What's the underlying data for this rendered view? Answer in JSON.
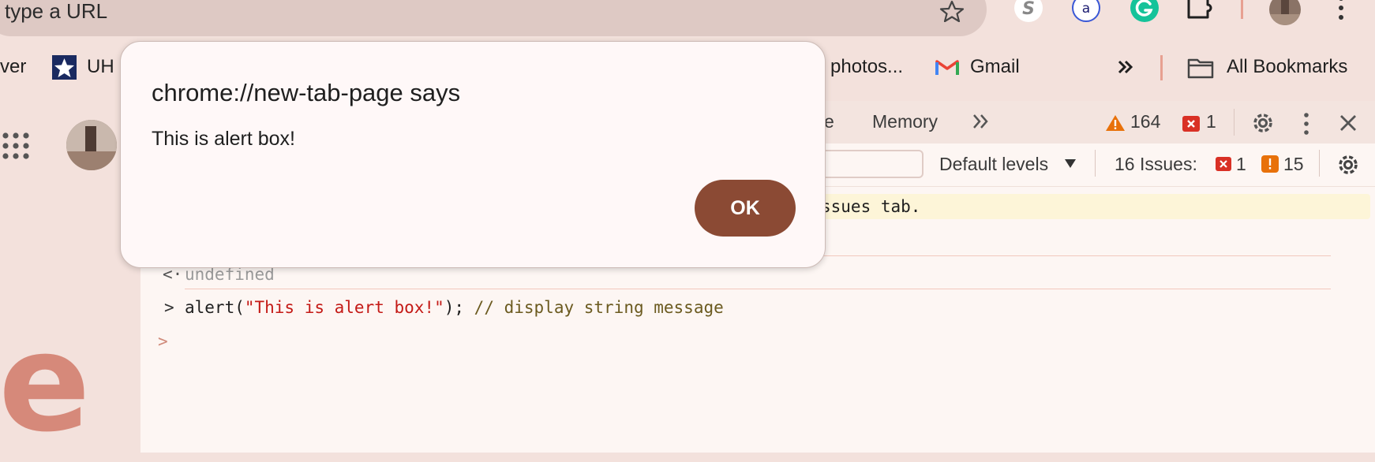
{
  "omnibox": {
    "placeholder_text": "type a URL"
  },
  "bookmarks": {
    "left_partial": "ver",
    "uh": "UH",
    "photos": "photos...",
    "gmail": "Gmail",
    "all_bookmarks": "All Bookmarks"
  },
  "devtools": {
    "tabs": {
      "partial": "e",
      "memory": "Memory"
    },
    "counts": {
      "warnings": "164",
      "errors": "1"
    },
    "filter": {
      "levels": "Default levels"
    },
    "issues": {
      "label": "16 Issues:",
      "errors": "1",
      "warnings": "15"
    },
    "console": {
      "issues_banner": "ssues tab.",
      "result_arrow": "<·",
      "result": "undefined",
      "input_arrow": ">",
      "code_prefix": "alert(",
      "code_string": "\"This is alert box!\"",
      "code_suffix": "); ",
      "code_comment": "// display string message",
      "prompt": ">"
    }
  },
  "alert": {
    "title": "chrome://new-tab-page says",
    "message": "This is alert box!",
    "ok_label": "OK"
  },
  "page": {
    "logo_letter": "e"
  },
  "colors": {
    "accent": "#8b4a34",
    "background": "#f3e1dc",
    "error": "#d93025",
    "warning": "#e8710a"
  },
  "icons": [
    "star-icon",
    "ext-s-icon",
    "ext-a-icon",
    "grammarly-icon",
    "puzzle-icon",
    "avatar",
    "kebab-menu-icon",
    "uh-icon",
    "gmail-icon",
    "chevron-double-right-icon",
    "folder-icon",
    "apps-grid-icon",
    "warning-icon",
    "error-icon",
    "settings-gear-icon",
    "close-icon",
    "caret-down-icon"
  ]
}
